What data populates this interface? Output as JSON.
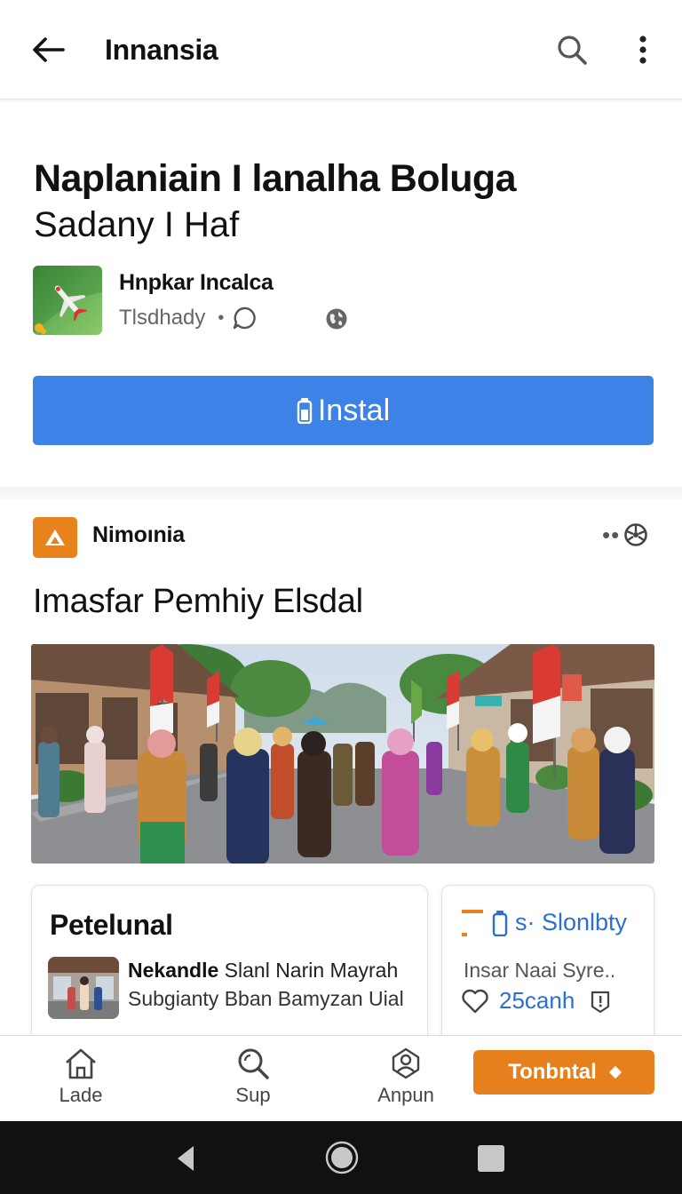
{
  "topbar": {
    "title": "Innansia",
    "back_icon": "arrow-left-icon",
    "search_icon": "search-icon",
    "more_icon": "more-vert-icon"
  },
  "app": {
    "title": "Naplaniain I lanalha Boluga",
    "subtitle": "Sadany I Haf",
    "developer": "Hnpkar Incalca",
    "category": "Tlsdhady",
    "install_label": "Instal",
    "accent": "#3d82e6"
  },
  "feed": {
    "source_name": "Nimoınia",
    "headline": "Imasfar Pemhiy Elsdal",
    "cards": {
      "left": {
        "title": "Petelunal",
        "bold": "Nekandle",
        "line1_rest": " Slanl Narin Mayrah",
        "line2": "Subgianty Bban Bamyzan Uial"
      },
      "right": {
        "tag": "s· Slonlbty",
        "sub": "Insar Naai Syre..",
        "likes": "25canh"
      }
    }
  },
  "bottom_nav": {
    "items": [
      {
        "label": "Lade",
        "icon": "home-icon"
      },
      {
        "label": "Sup",
        "icon": "search-icon"
      },
      {
        "label": "Anpun",
        "icon": "account-icon"
      }
    ],
    "cta_label": "Tonbntal",
    "cta_color": "#e6801d"
  }
}
